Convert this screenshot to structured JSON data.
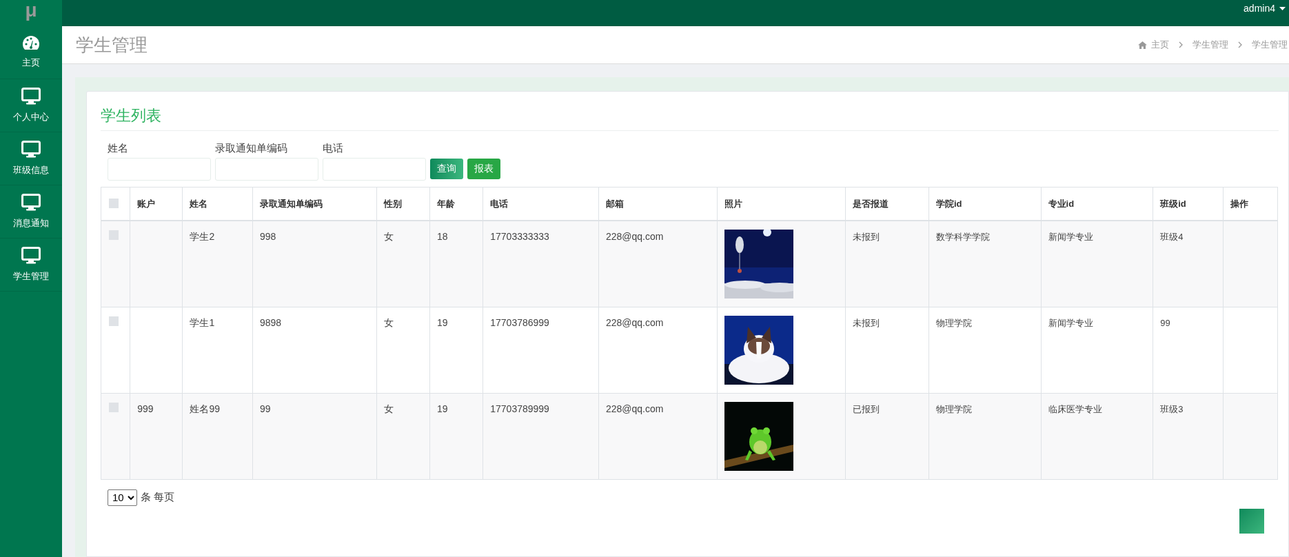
{
  "topbar": {
    "logo": "μ",
    "user": "admin4"
  },
  "sidebar": {
    "items": [
      {
        "label": "主页"
      },
      {
        "label": "个人中心"
      },
      {
        "label": "班级信息"
      },
      {
        "label": "消息通知"
      },
      {
        "label": "学生管理"
      }
    ]
  },
  "header": {
    "title": "学生管理",
    "breadcrumb": [
      "主页",
      "学生管理",
      "学生管理"
    ]
  },
  "card": {
    "title": "学生列表",
    "filters": [
      {
        "label": "姓名"
      },
      {
        "label": "录取通知单编码"
      },
      {
        "label": "电话"
      }
    ],
    "buttons": [
      "查询",
      "报表"
    ],
    "table": {
      "select_all_checked": false,
      "columns": [
        "账户",
        "姓名",
        "录取通知单编码",
        "性别",
        "年龄",
        "电话",
        "邮箱",
        "照片",
        "是否报道",
        "学院id",
        "专业id",
        "班级id",
        "操作"
      ],
      "rows": [
        {
          "checked": false,
          "name": "学生2",
          "admission_code": "998",
          "gender": "女",
          "age": "18",
          "phone": "17703333333",
          "email": "228@qq.com",
          "reported": "未报到",
          "college_id": "数学科学学院",
          "major_id": "新闻学专业",
          "class_id": "班级4"
        },
        {
          "checked": false,
          "name": "学生1",
          "admission_code": "9898",
          "gender": "女",
          "age": "19",
          "phone": "17703786999",
          "email": "228@qq.com",
          "reported": "未报到",
          "college_id": "物理学院",
          "major_id": "新闻学专业",
          "class_id": "99"
        },
        {
          "checked": false,
          "account": "999",
          "name": "姓名99",
          "admission_code": "99",
          "gender": "女",
          "age": "19",
          "phone": "17703789999",
          "email": "228@qq.com",
          "reported": "已报到",
          "college_id": "物理学院",
          "major_id": "临床医学专业",
          "class_id": "班级3"
        }
      ]
    },
    "pagination": {
      "page_size": "10",
      "label": "条 每页"
    }
  }
}
